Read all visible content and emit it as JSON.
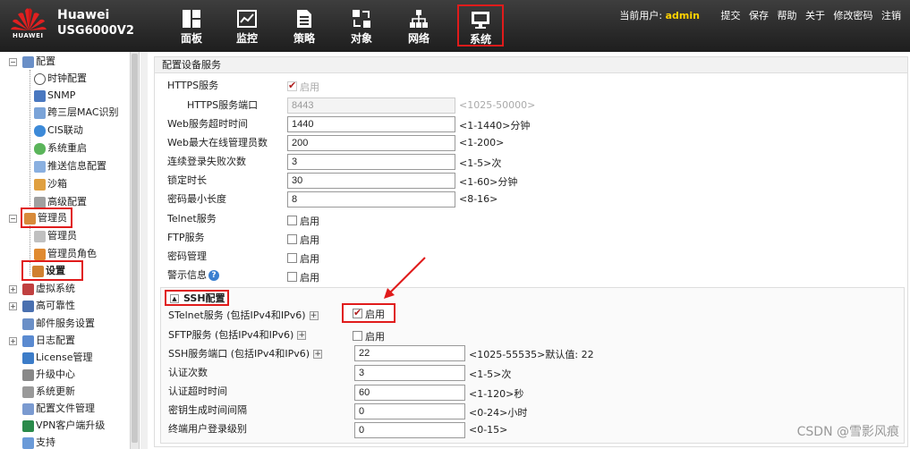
{
  "header": {
    "logo_text": "HUAWEI",
    "brand": "Huawei",
    "model": "USG6000V2",
    "nav": [
      {
        "label": "面板",
        "icon": "dashboard-icon"
      },
      {
        "label": "监控",
        "icon": "monitor-chart-icon"
      },
      {
        "label": "策略",
        "icon": "policy-document-icon"
      },
      {
        "label": "对象",
        "icon": "object-icon"
      },
      {
        "label": "网络",
        "icon": "network-topology-icon"
      },
      {
        "label": "系统",
        "icon": "system-monitor-icon",
        "active": true
      }
    ],
    "user_label": "当前用户:",
    "user": "admin",
    "actions": [
      "提交",
      "保存",
      "帮助",
      "关于",
      "修改密码",
      "注销"
    ]
  },
  "sidebar": {
    "items": [
      {
        "label": "配置",
        "level": 0,
        "expander": "−"
      },
      {
        "label": "时钟配置",
        "level": 1
      },
      {
        "label": "SNMP",
        "level": 1
      },
      {
        "label": "跨三层MAC识别",
        "level": 1
      },
      {
        "label": "CIS联动",
        "level": 1
      },
      {
        "label": "系统重启",
        "level": 1
      },
      {
        "label": "推送信息配置",
        "level": 1
      },
      {
        "label": "沙箱",
        "level": 1
      },
      {
        "label": "高级配置",
        "level": 1
      },
      {
        "label": "管理员",
        "level": 0,
        "expander": "−",
        "highlight": true
      },
      {
        "label": "管理员",
        "level": 1
      },
      {
        "label": "管理员角色",
        "level": 1
      },
      {
        "label": "设置",
        "level": 1,
        "highlight": true,
        "bold": true
      },
      {
        "label": "虚拟系统",
        "level": 0,
        "expander": "+"
      },
      {
        "label": "高可靠性",
        "level": 0,
        "expander": "+"
      },
      {
        "label": "邮件服务设置",
        "level": 0
      },
      {
        "label": "日志配置",
        "level": 0,
        "expander": "+"
      },
      {
        "label": "License管理",
        "level": 0
      },
      {
        "label": "升级中心",
        "level": 0
      },
      {
        "label": "系统更新",
        "level": 0
      },
      {
        "label": "配置文件管理",
        "level": 0
      },
      {
        "label": "VPN客户端升级",
        "level": 0
      },
      {
        "label": "支持",
        "level": 0
      }
    ]
  },
  "main": {
    "title": "配置设备服务",
    "enable_label": "启用",
    "fields": [
      {
        "label": "HTTPS服务",
        "type": "checkbox",
        "checked": true,
        "disabled": true
      },
      {
        "label": "HTTPS服务端口",
        "type": "input",
        "value": "8443",
        "hint": "<1025-50000>",
        "disabled": true,
        "indent": true
      },
      {
        "label": "Web服务超时时间",
        "type": "input",
        "value": "1440",
        "hint": "<1-1440>分钟"
      },
      {
        "label": "Web最大在线管理员数",
        "type": "input",
        "value": "200",
        "hint": "<1-200>"
      },
      {
        "label": "连续登录失败次数",
        "type": "input",
        "value": "3",
        "hint": "<1-5>次"
      },
      {
        "label": "锁定时长",
        "type": "input",
        "value": "30",
        "hint": "<1-60>分钟"
      },
      {
        "label": "密码最小长度",
        "type": "input",
        "value": "8",
        "hint": "<8-16>"
      },
      {
        "label": "Telnet服务",
        "type": "checkbox",
        "checked": false
      },
      {
        "label": "FTP服务",
        "type": "checkbox",
        "checked": false
      },
      {
        "label": "密码管理",
        "type": "checkbox",
        "checked": false
      },
      {
        "label": "警示信息",
        "type": "checkbox",
        "checked": false,
        "help": true
      }
    ],
    "ssh": {
      "title": "SSH配置",
      "fields": [
        {
          "label": "STelnet服务 (包括IPv4和IPv6)",
          "type": "checkbox",
          "checked": true,
          "plus": true,
          "highlight": true
        },
        {
          "label": "SFTP服务 (包括IPv4和IPv6)",
          "type": "checkbox",
          "checked": false,
          "plus": true
        },
        {
          "label": "SSH服务端口 (包括IPv4和IPv6)",
          "type": "input",
          "value": "22",
          "hint": "<1025-55535>默认值: 22",
          "plus": true
        },
        {
          "label": "认证次数",
          "type": "input",
          "value": "3",
          "hint": "<1-5>次"
        },
        {
          "label": "认证超时时间",
          "type": "input",
          "value": "60",
          "hint": "<1-120>秒"
        },
        {
          "label": "密钥生成时间间隔",
          "type": "input",
          "value": "0",
          "hint": "<0-24>小时"
        },
        {
          "label": "终端用户登录级别",
          "type": "input",
          "value": "0",
          "hint": "<0-15>"
        }
      ]
    }
  },
  "watermark": "CSDN @雪影风痕",
  "colors": {
    "highlight": "#e01b1b",
    "topbar": "#2a2a2a",
    "user": "#ffd200",
    "help": "#3a7fd0"
  }
}
